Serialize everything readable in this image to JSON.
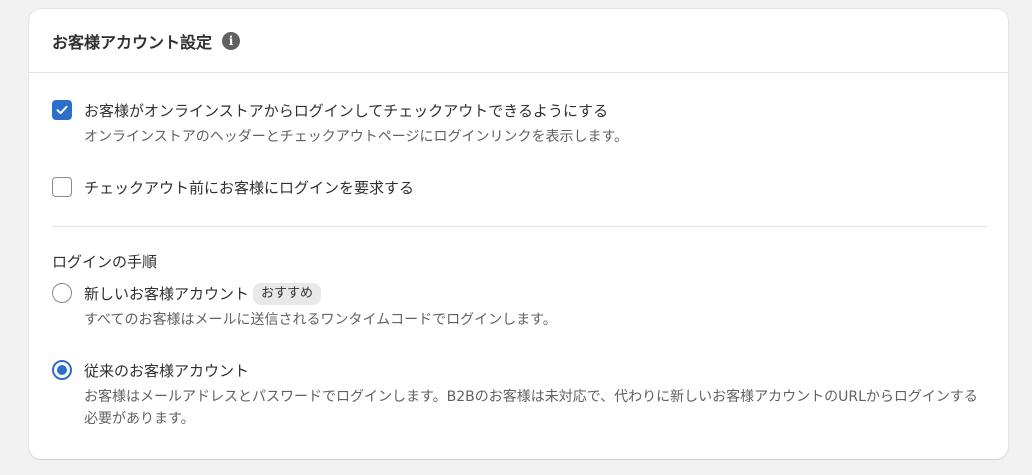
{
  "card": {
    "title": "お客様アカウント設定",
    "info_icon": "info-icon"
  },
  "options": {
    "enable_login": {
      "checked": true,
      "label": "お客様がオンラインストアからログインしてチェックアウトできるようにする",
      "help": "オンラインストアのヘッダーとチェックアウトページにログインリンクを表示します。"
    },
    "require_login": {
      "checked": false,
      "label": "チェックアウト前にお客様にログインを要求する"
    }
  },
  "login_method": {
    "section_label": "ログインの手順",
    "new_accounts": {
      "selected": false,
      "label": "新しいお客様アカウント",
      "badge": "おすすめ",
      "help": "すべてのお客様はメールに送信されるワンタイムコードでログインします。"
    },
    "classic_accounts": {
      "selected": true,
      "label": "従来のお客様アカウント",
      "help": "お客様はメールアドレスとパスワードでログインします。B2Bのお客様は未対応で、代わりに新しいお客様アカウントのURLからログインする必要があります。"
    }
  },
  "colors": {
    "accent": "#2c6ecb",
    "background": "#f1f1f1",
    "card": "#ffffff",
    "muted_text": "#616161"
  }
}
